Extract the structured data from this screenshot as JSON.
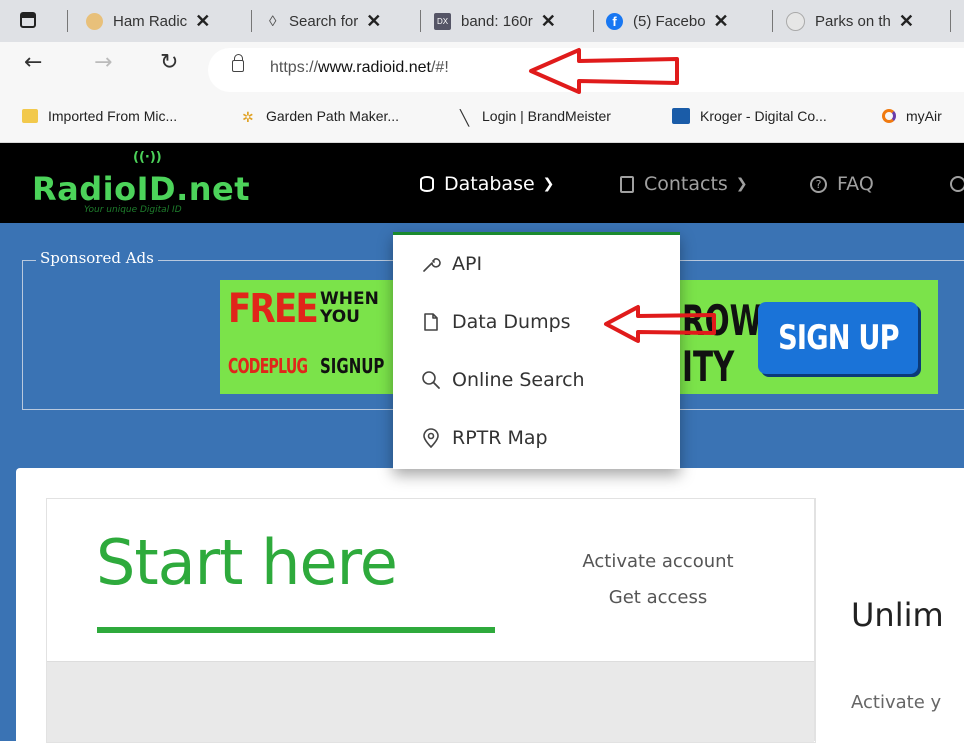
{
  "browser": {
    "tabs": [
      {
        "title": "Ham Radic",
        "close": "✕"
      },
      {
        "title": "Search for",
        "close": "✕"
      },
      {
        "title": "band: 160r",
        "close": "✕"
      },
      {
        "title": "(5) Facebo",
        "close": "✕"
      },
      {
        "title": "Parks on th",
        "close": "✕"
      }
    ],
    "url_prefix": "https://",
    "url_domain": "www.radioid.net",
    "url_suffix": "/#!",
    "bookmarks": [
      {
        "label": "Imported From Mic..."
      },
      {
        "label": "Garden Path Maker..."
      },
      {
        "label": "Login | BrandMeister"
      },
      {
        "label": "Kroger - Digital Co..."
      },
      {
        "label": "myAir"
      }
    ]
  },
  "site": {
    "logo_text": "RadioID.net",
    "logo_tagline": "Your unique Digital ID",
    "nav": [
      {
        "label": "Database",
        "icon": "database-icon"
      },
      {
        "label": "Contacts",
        "icon": "contacts-icon"
      },
      {
        "label": "FAQ",
        "icon": "question-circle-icon"
      }
    ],
    "sponsored_label": "Sponsored Ads",
    "banner": {
      "free": "FREE",
      "when_you": "WHEN YOU",
      "codeplug": "CODEPLUG",
      "signup_word": "SIGNUP",
      "row": "ROW",
      "ity": "ITY",
      "cta": "SIGN UP"
    },
    "dropdown": [
      {
        "label": "API",
        "icon": "wrench-icon"
      },
      {
        "label": "Data Dumps",
        "icon": "file-icon"
      },
      {
        "label": "Online Search",
        "icon": "search-icon"
      },
      {
        "label": "RPTR Map",
        "icon": "map-pin-icon"
      }
    ],
    "card": {
      "start_here": "Start here",
      "activate_account": "Activate account",
      "get_access": "Get access",
      "unlim": "Unlim",
      "activate_y": "Activate y"
    }
  },
  "colors": {
    "brand_green": "#2eaa3c",
    "header_blue": "#3a73b4",
    "annotation_red": "#e01b1b"
  }
}
